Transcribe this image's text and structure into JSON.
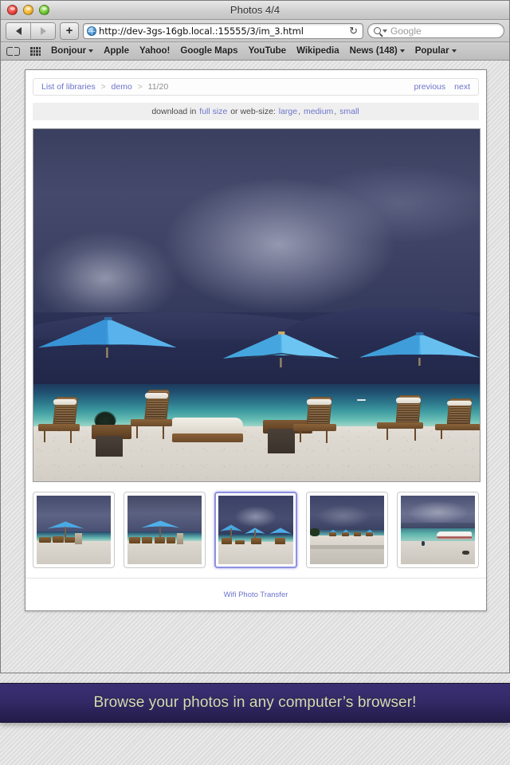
{
  "window": {
    "title": "Photos 4/4",
    "traffic_lights": [
      "close-button",
      "minimize-button",
      "zoom-button"
    ]
  },
  "toolbar": {
    "back_label": "◀",
    "forward_label": "▶",
    "add_tab_label": "+",
    "url": "http://dev-3gs-16gb.local.:15555/3/im_3.html",
    "reload_label": "↻",
    "search_placeholder": "Google"
  },
  "bookmarks": {
    "items": [
      {
        "label": "Bonjour",
        "has_menu": true
      },
      {
        "label": "Apple",
        "has_menu": false
      },
      {
        "label": "Yahoo!",
        "has_menu": false
      },
      {
        "label": "Google Maps",
        "has_menu": false
      },
      {
        "label": "YouTube",
        "has_menu": false
      },
      {
        "label": "Wikipedia",
        "has_menu": false
      },
      {
        "label": "News (148)",
        "has_menu": true
      },
      {
        "label": "Popular",
        "has_menu": true
      }
    ]
  },
  "page": {
    "breadcrumb": {
      "root": "List of libraries",
      "sep1": ">",
      "library": "demo",
      "sep2": ">",
      "position": "11/20"
    },
    "nav": {
      "previous": "previous",
      "next": "next"
    },
    "download": {
      "prefix": "download in",
      "full_size": "full size",
      "middle": "or web-size:",
      "large": "large",
      "comma1": ",",
      "medium": "medium",
      "comma2": ",",
      "small": "small"
    },
    "photo": {
      "alt": "Beach with blue umbrellas and wooden lounge chairs under a stormy sky"
    },
    "thumbnails": [
      {
        "index": 1,
        "selected": false,
        "alt": "One blue umbrella with lounge chairs on beach"
      },
      {
        "index": 2,
        "selected": false,
        "alt": "One blue umbrella with two lounge chairs on beach"
      },
      {
        "index": 3,
        "selected": true,
        "alt": "Three blue umbrellas and lounge chairs on beach"
      },
      {
        "index": 4,
        "selected": false,
        "alt": "Row of blue umbrellas behind a sea wall"
      },
      {
        "index": 5,
        "selected": false,
        "alt": "White speedboat moored at the shoreline"
      }
    ],
    "footer_link": "Wifi Photo Transfer"
  },
  "banner": {
    "text": "Browse your photos in any computer’s browser!"
  },
  "colors": {
    "link": "#6c74cc",
    "selected_thumb_border": "#8f90e0",
    "banner_bg": "#342a68",
    "banner_text": "#d7dcb4",
    "page_bg": "#e2e2e2"
  }
}
